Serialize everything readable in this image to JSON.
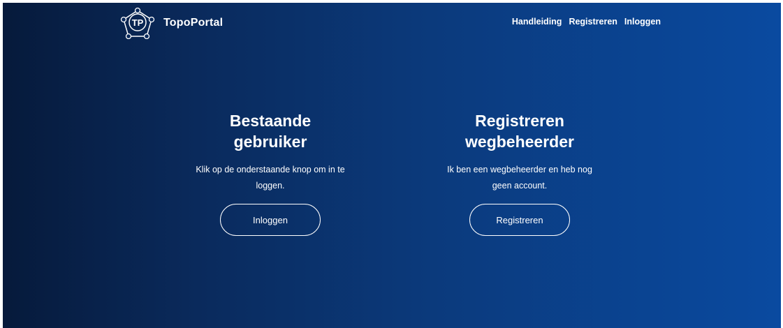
{
  "header": {
    "logo_initials": "TP",
    "brand": "TopoPortal",
    "nav": {
      "manual": "Handleiding",
      "register": "Registreren",
      "login": "Inloggen"
    }
  },
  "cards": {
    "existing_user": {
      "title_line1": "Bestaande",
      "title_line2": "gebruiker",
      "text": "Klik op de onderstaande knop om in te loggen.",
      "button": "Inloggen"
    },
    "register_manager": {
      "title_line1": "Registreren",
      "title_line2": "wegbeheerder",
      "text": "Ik ben een wegbeheerder en heb nog geen account.",
      "button": "Registreren"
    }
  },
  "colors": {
    "background_start": "#061a3b",
    "background_end": "#0a4aa0",
    "text": "#ffffff"
  }
}
